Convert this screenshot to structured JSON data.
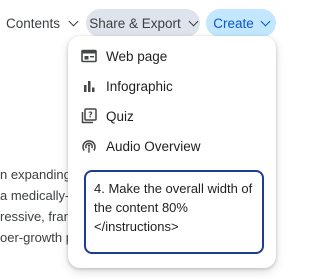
{
  "toolbar": {
    "contents_label": "Contents",
    "share_export_label": "Share & Export",
    "create_label": "Create"
  },
  "document": {
    "lines": [
      "n expanding pl",
      "a medically-gu",
      "ressive, franc",
      "oer-growth pr"
    ]
  },
  "create_menu": {
    "items": [
      {
        "label": "Web page",
        "icon": "web-page-icon"
      },
      {
        "label": "Infographic",
        "icon": "bar-chart-icon"
      },
      {
        "label": "Quiz",
        "icon": "quiz-icon"
      },
      {
        "label": "Audio Overview",
        "icon": "podcast-icon"
      }
    ],
    "prompt_lines": [
      "4. Make the overall width of",
      "the content 80%",
      "</instructions>"
    ]
  },
  "colors": {
    "share_button_bg": "#dfe4ec",
    "create_button_bg": "#c2e7ff",
    "create_button_text": "#0b57d0",
    "prompt_border": "#1a3f8f"
  }
}
